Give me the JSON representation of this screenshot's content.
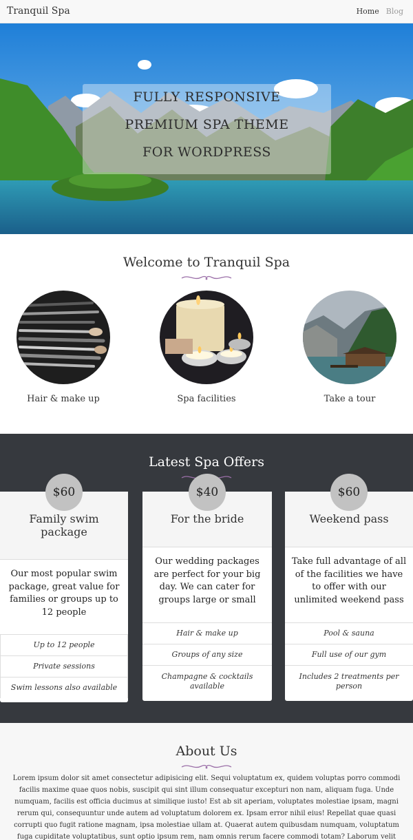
{
  "navbar": {
    "brand": "Tranquil Spa",
    "links": [
      {
        "label": "Home"
      },
      {
        "label": "Blog"
      }
    ]
  },
  "hero": {
    "lines": [
      "FULLY RESPONSIVE",
      "PREMIUM SPA THEME",
      "FOR WORDPRESS"
    ]
  },
  "welcome": {
    "title": "Welcome to Tranquil Spa",
    "features": [
      {
        "label": "Hair & make up",
        "image": "makeup-brushes"
      },
      {
        "label": "Spa facilities",
        "image": "candles"
      },
      {
        "label": "Take a tour",
        "image": "mountain-lake-cabin"
      }
    ]
  },
  "offers": {
    "title": "Latest Spa Offers",
    "cards": [
      {
        "price": "$60",
        "title": "Family swim package",
        "description": "Our most popular swim package, great value for families or groups up to 12 people",
        "features": [
          "Up to 12 people",
          "Private sessions",
          "Swim lessons also available"
        ]
      },
      {
        "price": "$40",
        "title": "For the bride",
        "description": "Our wedding packages are perfect for your big day. We can cater for groups large or small",
        "features": [
          "Hair & make up",
          "Groups of any size",
          "Champagne & cocktails available"
        ]
      },
      {
        "price": "$60",
        "title": "Weekend pass",
        "description": "Take full advantage of all of the facilities we have to offer with our unlimited weekend pass",
        "features": [
          "Pool & sauna",
          "Full use of our gym",
          "Includes 2 treatments per person"
        ]
      }
    ]
  },
  "about": {
    "title": "About Us",
    "text": "Lorem ipsum dolor sit amet consectetur adipisicing elit. Sequi voluptatum ex, quidem voluptas porro commodi facilis maxime quae quos nobis, suscipit qui sint illum consequatur excepturi non nam, aliquam fuga. Unde numquam, facilis est officia ducimus at similique iusto! Est ab sit aperiam, voluptates molestiae ipsam, magni rerum qui, consequuntur unde autem ad voluptatum dolorem ex. Ipsam error nihil eius! Repellat quae quasi corrupti quo fugit ratione magnam, ipsa molestiae ullam at. Quaerat autem quibusdam numquam, voluptatum fuga cupiditate voluptatibus, sunt optio ipsum rem, nam omnis rerum facere commodi totam? Laborum velit"
  },
  "colors": {
    "navbar_bg": "#f8f8f8",
    "offers_bg": "#36393e",
    "flourish": "#9b6fa8",
    "price_badge": "#c2c2c2"
  }
}
